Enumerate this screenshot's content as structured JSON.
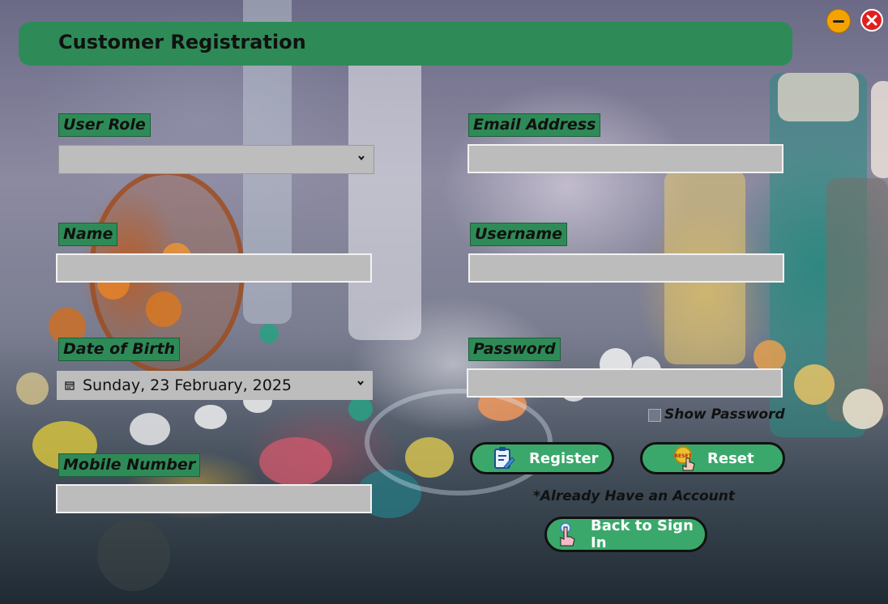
{
  "window": {
    "title": "Customer Registration",
    "minimize_color": "#f5a300",
    "close_color": "#e02020"
  },
  "theme": {
    "accent": "#2e8b57",
    "button": "#3aa86a",
    "field_bg": "#bcbcbc"
  },
  "form": {
    "user_role": {
      "label": "User Role",
      "value": ""
    },
    "name": {
      "label": "Name",
      "value": ""
    },
    "dob": {
      "label": "Date of Birth",
      "value": "Sunday, 23 February, 2025",
      "icon": "calendar-icon"
    },
    "mobile": {
      "label": "Mobile Number",
      "value": ""
    },
    "email": {
      "label": "Email Address",
      "value": ""
    },
    "username": {
      "label": "Username",
      "value": ""
    },
    "password": {
      "label": "Password",
      "value": ""
    },
    "show_password": {
      "label": "Show Password",
      "checked": false
    }
  },
  "actions": {
    "register": {
      "label": "Register",
      "icon": "register-clipboard-icon"
    },
    "reset": {
      "label": "Reset",
      "icon": "reset-hand-icon"
    },
    "already_text": "*Already Have an Account",
    "back": {
      "label": "Back to Sign In",
      "icon": "pointer-hand-icon"
    }
  }
}
